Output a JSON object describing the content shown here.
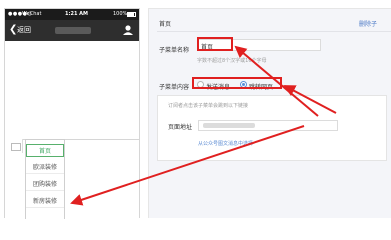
{
  "phone": {
    "status": {
      "dots": "●●●●○",
      "carrier": "WeChat",
      "wifi": "⌔",
      "time": "1:21 AM",
      "battery_pct": "100%"
    },
    "nav": {
      "back_chevron": "❮",
      "back": "返回"
    },
    "submenu_items": [
      "首页",
      "欧派装修",
      "团购装修",
      "新房装修"
    ]
  },
  "edit": {
    "title": "首页",
    "delete": "删除子",
    "name_label": "子菜单名称",
    "name_value": "首页",
    "name_hint": "字数不超过8个汉字或16个字母",
    "content_label": "子菜单内容",
    "option_send": "发送消息",
    "option_jump": "跳转网页",
    "selected_option": "跳转网页",
    "content_desc": "订阅者点击该子菜单会跳到以下链接",
    "url_label": "页面地址",
    "from_account_link": "从公众号图文消息中选择"
  },
  "colors": {
    "annotation_red": "#e02020",
    "link_blue": "#5a8ad2",
    "selected_green": "#41a863"
  }
}
